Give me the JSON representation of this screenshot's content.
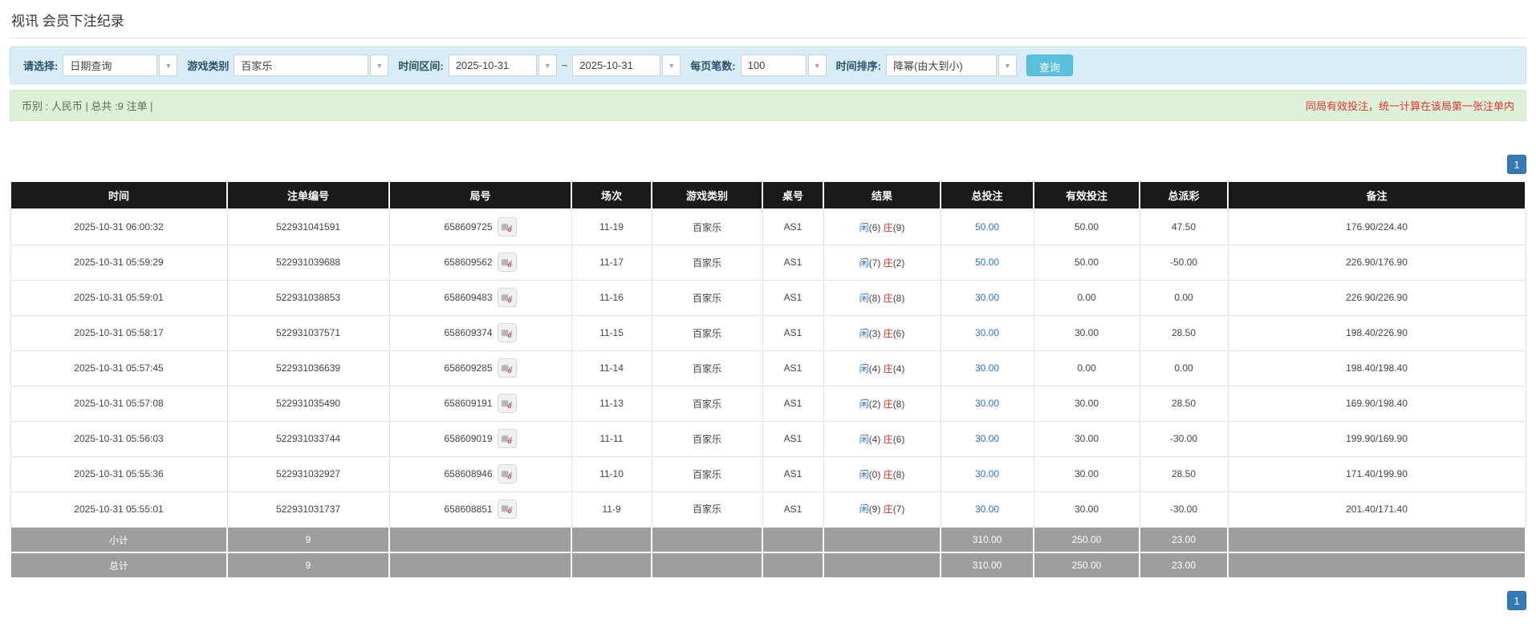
{
  "page": {
    "title": "视讯 会员下注纪录"
  },
  "filters": {
    "query_type_label": "请选择:",
    "query_type_value": "日期查询",
    "game_type_label": "游戏类别",
    "game_type_value": "百家乐",
    "date_range_label": "时间区间:",
    "date_from": "2025-10-31",
    "date_to": "2025-10-31",
    "range_separator": "~",
    "page_size_label": "每页笔数:",
    "page_size_value": "100",
    "sort_label": "时间排序:",
    "sort_value": "降幂(由大到小)",
    "search_button": "查询"
  },
  "summary": {
    "left_text": "币别 : 人民币 | 总共 :9 注单 |",
    "right_note": "同局有效投注，统一计算在该局第一张注单内"
  },
  "pagination": {
    "page": "1"
  },
  "table": {
    "headers": [
      "时间",
      "注单编号",
      "局号",
      "场次",
      "游戏类别",
      "桌号",
      "结果",
      "总投注",
      "有效投注",
      "总派彩",
      "备注"
    ],
    "rows": [
      {
        "time": "2025-10-31 06:00:32",
        "bet_id": "522931041591",
        "round": "658609725",
        "session": "11-19",
        "game": "百家乐",
        "table_no": "AS1",
        "player_label": "闲",
        "player_score": "(6)",
        "banker_label": "庄",
        "banker_score": "(9)",
        "total_bet": "50.00",
        "valid_bet": "50.00",
        "payout": "47.50",
        "note": "176.90/224.40"
      },
      {
        "time": "2025-10-31 05:59:29",
        "bet_id": "522931039688",
        "round": "658609562",
        "session": "11-17",
        "game": "百家乐",
        "table_no": "AS1",
        "player_label": "闲",
        "player_score": "(7)",
        "banker_label": "庄",
        "banker_score": "(2)",
        "total_bet": "50.00",
        "valid_bet": "50.00",
        "payout": "-50.00",
        "note": "226.90/176.90"
      },
      {
        "time": "2025-10-31 05:59:01",
        "bet_id": "522931038853",
        "round": "658609483",
        "session": "11-16",
        "game": "百家乐",
        "table_no": "AS1",
        "player_label": "闲",
        "player_score": "(8)",
        "banker_label": "庄",
        "banker_score": "(8)",
        "total_bet": "30.00",
        "valid_bet": "0.00",
        "payout": "0.00",
        "note": "226.90/226.90"
      },
      {
        "time": "2025-10-31 05:58:17",
        "bet_id": "522931037571",
        "round": "658609374",
        "session": "11-15",
        "game": "百家乐",
        "table_no": "AS1",
        "player_label": "闲",
        "player_score": "(3)",
        "banker_label": "庄",
        "banker_score": "(6)",
        "total_bet": "30.00",
        "valid_bet": "30.00",
        "payout": "28.50",
        "note": "198.40/226.90"
      },
      {
        "time": "2025-10-31 05:57:45",
        "bet_id": "522931036639",
        "round": "658609285",
        "session": "11-14",
        "game": "百家乐",
        "table_no": "AS1",
        "player_label": "闲",
        "player_score": "(4)",
        "banker_label": "庄",
        "banker_score": "(4)",
        "total_bet": "30.00",
        "valid_bet": "0.00",
        "payout": "0.00",
        "note": "198.40/198.40"
      },
      {
        "time": "2025-10-31 05:57:08",
        "bet_id": "522931035490",
        "round": "658609191",
        "session": "11-13",
        "game": "百家乐",
        "table_no": "AS1",
        "player_label": "闲",
        "player_score": "(2)",
        "banker_label": "庄",
        "banker_score": "(8)",
        "total_bet": "30.00",
        "valid_bet": "30.00",
        "payout": "28.50",
        "note": "169.90/198.40"
      },
      {
        "time": "2025-10-31 05:56:03",
        "bet_id": "522931033744",
        "round": "658609019",
        "session": "11-11",
        "game": "百家乐",
        "table_no": "AS1",
        "player_label": "闲",
        "player_score": "(4)",
        "banker_label": "庄",
        "banker_score": "(6)",
        "total_bet": "30.00",
        "valid_bet": "30.00",
        "payout": "-30.00",
        "note": "199.90/169.90"
      },
      {
        "time": "2025-10-31 05:55:36",
        "bet_id": "522931032927",
        "round": "658608946",
        "session": "11-10",
        "game": "百家乐",
        "table_no": "AS1",
        "player_label": "闲",
        "player_score": "(0)",
        "banker_label": "庄",
        "banker_score": "(8)",
        "total_bet": "30.00",
        "valid_bet": "30.00",
        "payout": "28.50",
        "note": "171.40/199.90"
      },
      {
        "time": "2025-10-31 05:55:01",
        "bet_id": "522931031737",
        "round": "658608851",
        "session": "11-9",
        "game": "百家乐",
        "table_no": "AS1",
        "player_label": "闲",
        "player_score": "(9)",
        "banker_label": "庄",
        "banker_score": "(7)",
        "total_bet": "30.00",
        "valid_bet": "30.00",
        "payout": "-30.00",
        "note": "201.40/171.40"
      }
    ],
    "subtotal": {
      "label": "小计",
      "count": "9",
      "total_bet": "310.00",
      "valid_bet": "250.00",
      "payout": "23.00"
    },
    "total": {
      "label": "总计",
      "count": "9",
      "total_bet": "310.00",
      "valid_bet": "250.00",
      "payout": "23.00"
    }
  },
  "colors": {
    "header_bg": "#1a1a1a",
    "filter_bg": "#d9edf7",
    "summary_bg": "#dff0d8",
    "accent_blue": "#2a72de",
    "negative_red": "#e02b20",
    "pager_blue": "#337ab7",
    "search_button_bg": "#5bc0de",
    "total_row_bg": "#9d9d9d"
  }
}
